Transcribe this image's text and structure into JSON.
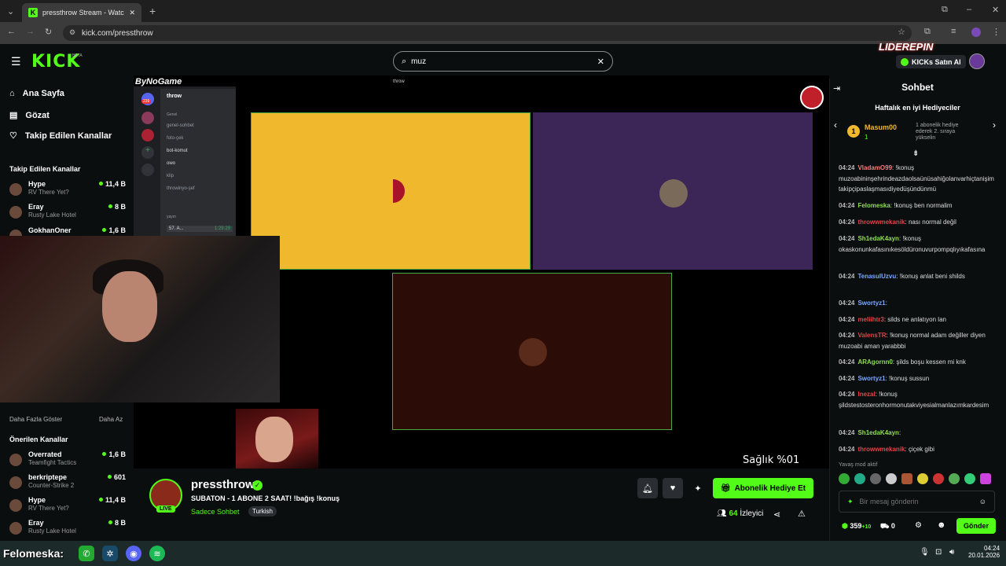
{
  "browser": {
    "tab_title": "pressthrow Stream - Watch Live",
    "url": "kick.com/pressthrow"
  },
  "header": {
    "logo": "KICK",
    "beta": "BETA",
    "search_value": "muz",
    "partner_logo": "LIDEREPIN",
    "kicks_button": "KICKs Satın Al"
  },
  "sidebar": {
    "nav": [
      {
        "label": "Ana Sayfa",
        "icon": "home-icon"
      },
      {
        "label": "Gözat",
        "icon": "browse-icon"
      },
      {
        "label": "Takip Edilen Kanallar",
        "icon": "heart-icon"
      }
    ],
    "following_title": "Takip Edilen Kanallar",
    "following": [
      {
        "name": "Hype",
        "game": "RV There Yet?",
        "viewers": "11,4 B"
      },
      {
        "name": "Eray",
        "game": "Rusty Lake Hotel",
        "viewers": "8 B"
      },
      {
        "name": "GokhanOner",
        "game": "",
        "viewers": "1,6 B"
      }
    ],
    "show_more": "Daha Fazla Göster",
    "show_less": "Daha Az",
    "recommended_title": "Önerilen Kanallar",
    "recommended": [
      {
        "name": "Overrated",
        "game": "Teamfight Tactics",
        "viewers": "1,6 B"
      },
      {
        "name": "berkriptepe",
        "game": "Counter-Strike 2",
        "viewers": "601"
      },
      {
        "name": "Hype",
        "game": "RV There Yet?",
        "viewers": "11,4 B"
      },
      {
        "name": "Eray",
        "game": "Rusty Lake Hotel",
        "viewers": "8 B"
      }
    ]
  },
  "player": {
    "overlay_title": "ByNoGame",
    "discord_server": "throw",
    "discord_window_title": "throw",
    "discord_badge": "239",
    "discord_category": "Genel",
    "discord_channels": [
      "genel-sohbet",
      "foto-çek",
      "bot-komut",
      "owo",
      "klip",
      "throwinyo-şef"
    ],
    "discord_voice_category": "yayın",
    "discord_voice_item": "57. A...",
    "discord_voice_time": "1:29:29",
    "hud_text": "Sağlık %01"
  },
  "stream": {
    "streamer": "pressthrow",
    "live": "LIVE",
    "title": "SUBATON - 1 ABONE 2 SAAT! !bağış !konuş",
    "category": "Sadece Sohbet",
    "tag": "Turkish",
    "gift_button": "Abonelik Hediye Et",
    "viewer_count": "64",
    "viewer_label": "İzleyici"
  },
  "chat": {
    "title": "Sohbet",
    "gifters_title": "Haftalık en iyi Hediyeciler",
    "top_gifter_rank": "1",
    "top_gifter_name": "Masum00",
    "top_gifter_count": "1",
    "gifter_hint": "1 abonelik hediye ederek 2. sıraya yükselin",
    "messages": [
      {
        "time": "04:24",
        "user": "VladamO99",
        "color": "#ff7a7a",
        "text": "!konuş muzoabininşehrindeazdaolsaünüsahiğolanvarhiçtanişim takipçipaslaşmasıdiyedüşündünmü"
      },
      {
        "time": "04:24",
        "user": "Felomeska",
        "color": "#8fdc55",
        "text": "!konuş ben normalim"
      },
      {
        "time": "04:24",
        "user": "throwwmekanik",
        "color": "#e0454a",
        "text": "nası normal değil"
      },
      {
        "time": "04:24",
        "user": "Sh1edaK4ayn",
        "color": "#8fdc55",
        "text": "!konuş okaskonunkafasınıkesöldüronuvurpompqlıyıkafasına"
      },
      {
        "time": "04:24",
        "user": "TenasulUzvu",
        "color": "#7aa7ff",
        "text": "!konuş anlat beni shilds"
      },
      {
        "time": "04:24",
        "user": "Swortyz1",
        "color": "#7aa7ff",
        "text": ""
      },
      {
        "time": "04:24",
        "user": "meliihtr3",
        "color": "#e0454a",
        "text": "silds ne anlatıyon lan"
      },
      {
        "time": "04:24",
        "user": "ValensTR",
        "color": "#e0454a",
        "text": "!konuş normal adam değiller diyen muzoabi aman yarabbbi"
      },
      {
        "time": "04:24",
        "user": "ARAgornn0",
        "color": "#8fdc55",
        "text": "şilds boşu kessen mi knk"
      },
      {
        "time": "04:24",
        "user": "Swortyz1",
        "color": "#7aa7ff",
        "text": "!konuş sussun"
      },
      {
        "time": "04:24",
        "user": "Inezal",
        "color": "#e0454a",
        "text": "!konuş şildstestosteronhormonutakviyesialmanlazımkardesim"
      },
      {
        "time": "04:24",
        "user": "Sh1edaK4ayn",
        "color": "#8fdc55",
        "text": ""
      },
      {
        "time": "04:24",
        "user": "throwwmekanik",
        "color": "#e0454a",
        "text": "çiçek gibi"
      }
    ],
    "slow_mode": "Yavaş mod aktif",
    "input_placeholder": "Bir mesaj gönderin",
    "points": "359",
    "points_bonus": "+10",
    "gift_count": "0",
    "send_button": "Gönder"
  },
  "taskbar": {
    "overlay_name": "Felomeska:",
    "time": "04:24",
    "date": "20.01.2026"
  },
  "colors": {
    "accent": "#53fc18",
    "bg": "#0b0e0f"
  }
}
